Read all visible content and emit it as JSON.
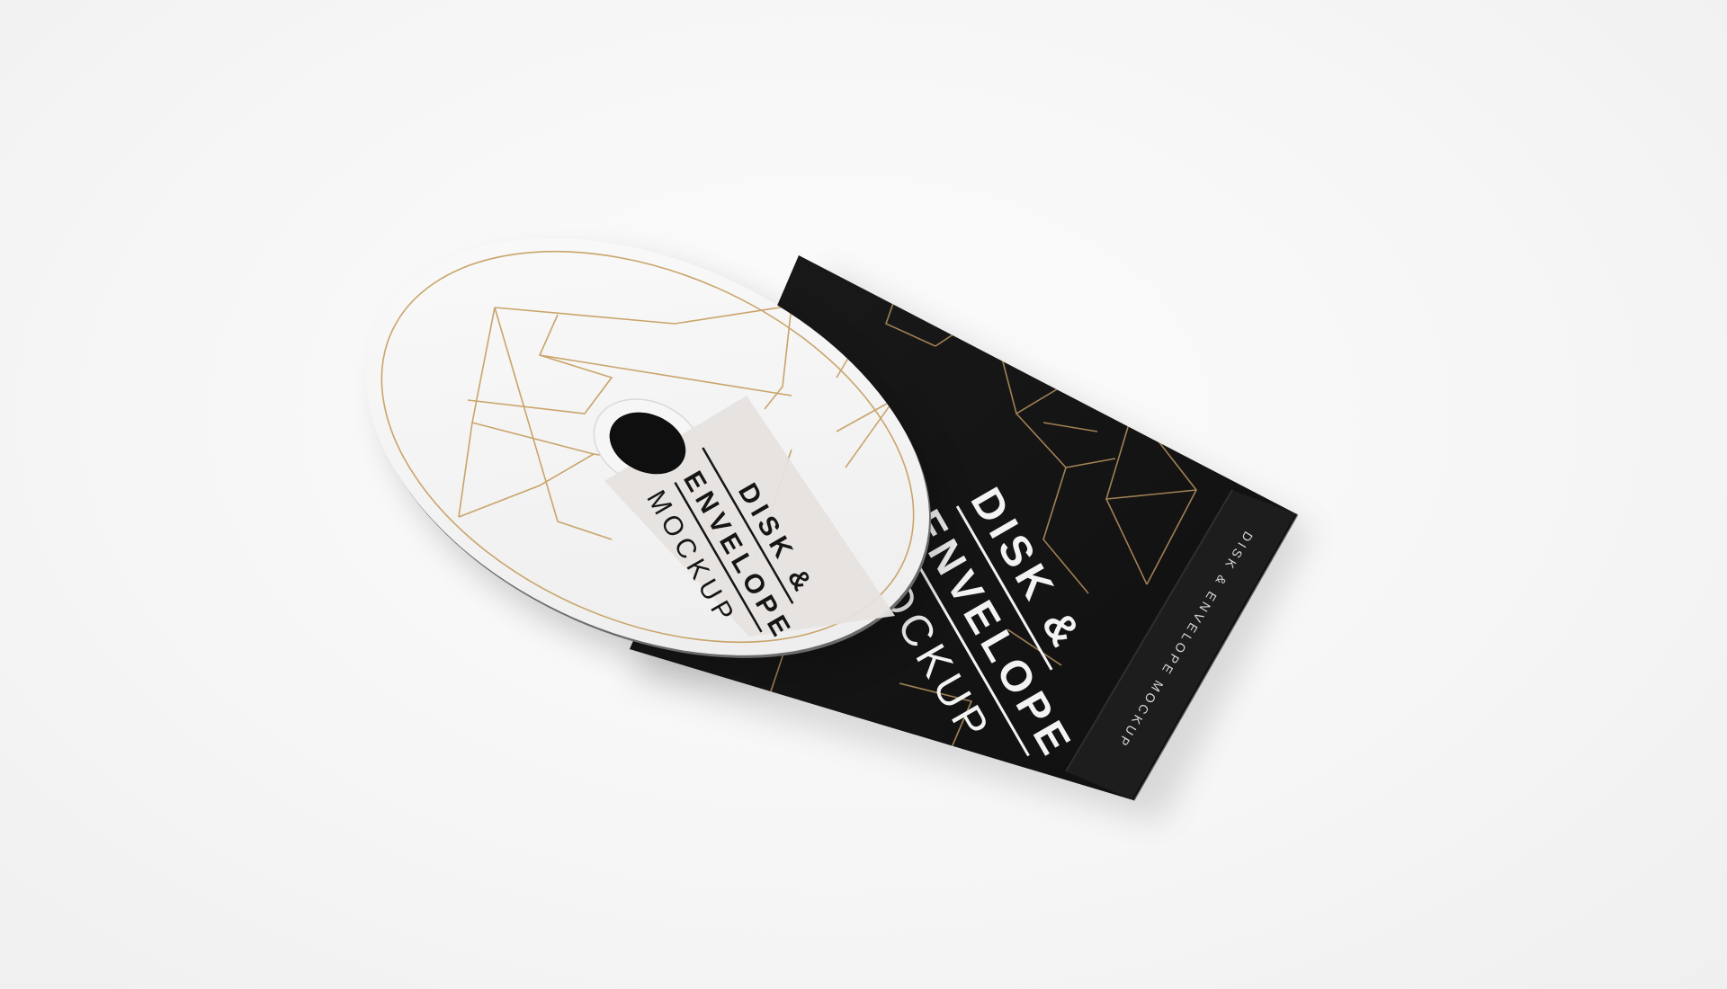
{
  "mockup": {
    "disc_label": {
      "line1": "DISK &",
      "line2": "ENVELOPE",
      "line3": "MOCKUP"
    },
    "envelope_print": {
      "line1": "DISK &",
      "line2": "ENVELOPE",
      "line3": "MOCKUP"
    },
    "flap_print": "DISK & ENVELOPE MOCKUP"
  },
  "colors": {
    "background": "#f7f7f7",
    "envelope": "#151515",
    "gold": "#c9a46a",
    "disc": "#f3f3f3",
    "label": "#e6e2df"
  }
}
